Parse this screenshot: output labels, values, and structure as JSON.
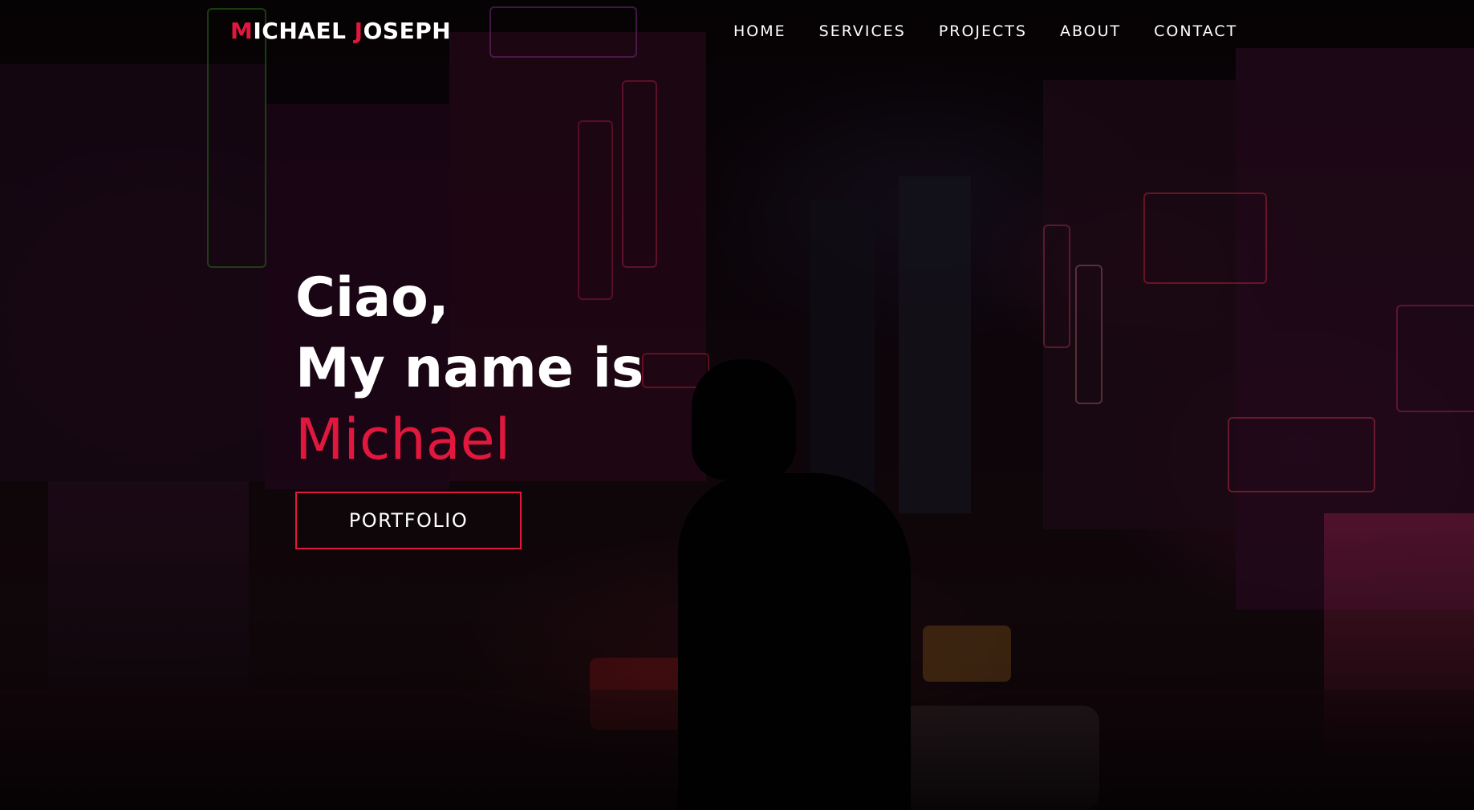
{
  "logo": {
    "first_initial": "M",
    "first_rest": "ICHAEL ",
    "last_initial": "J",
    "last_rest": "OSEPH"
  },
  "nav": {
    "items": [
      {
        "label": "HOME"
      },
      {
        "label": "SERVICES"
      },
      {
        "label": "PROJECTS"
      },
      {
        "label": "ABOUT"
      },
      {
        "label": "CONTACT"
      }
    ]
  },
  "hero": {
    "greeting_line1": "Ciao,",
    "greeting_line2": "My name is",
    "name": "Michael",
    "button_label": "PORTFOLIO"
  },
  "colors": {
    "accent": "#e0183e",
    "text": "#ffffff",
    "background": "#0b0407"
  },
  "background_image": {
    "description_icon": "neon-city-street-background"
  }
}
